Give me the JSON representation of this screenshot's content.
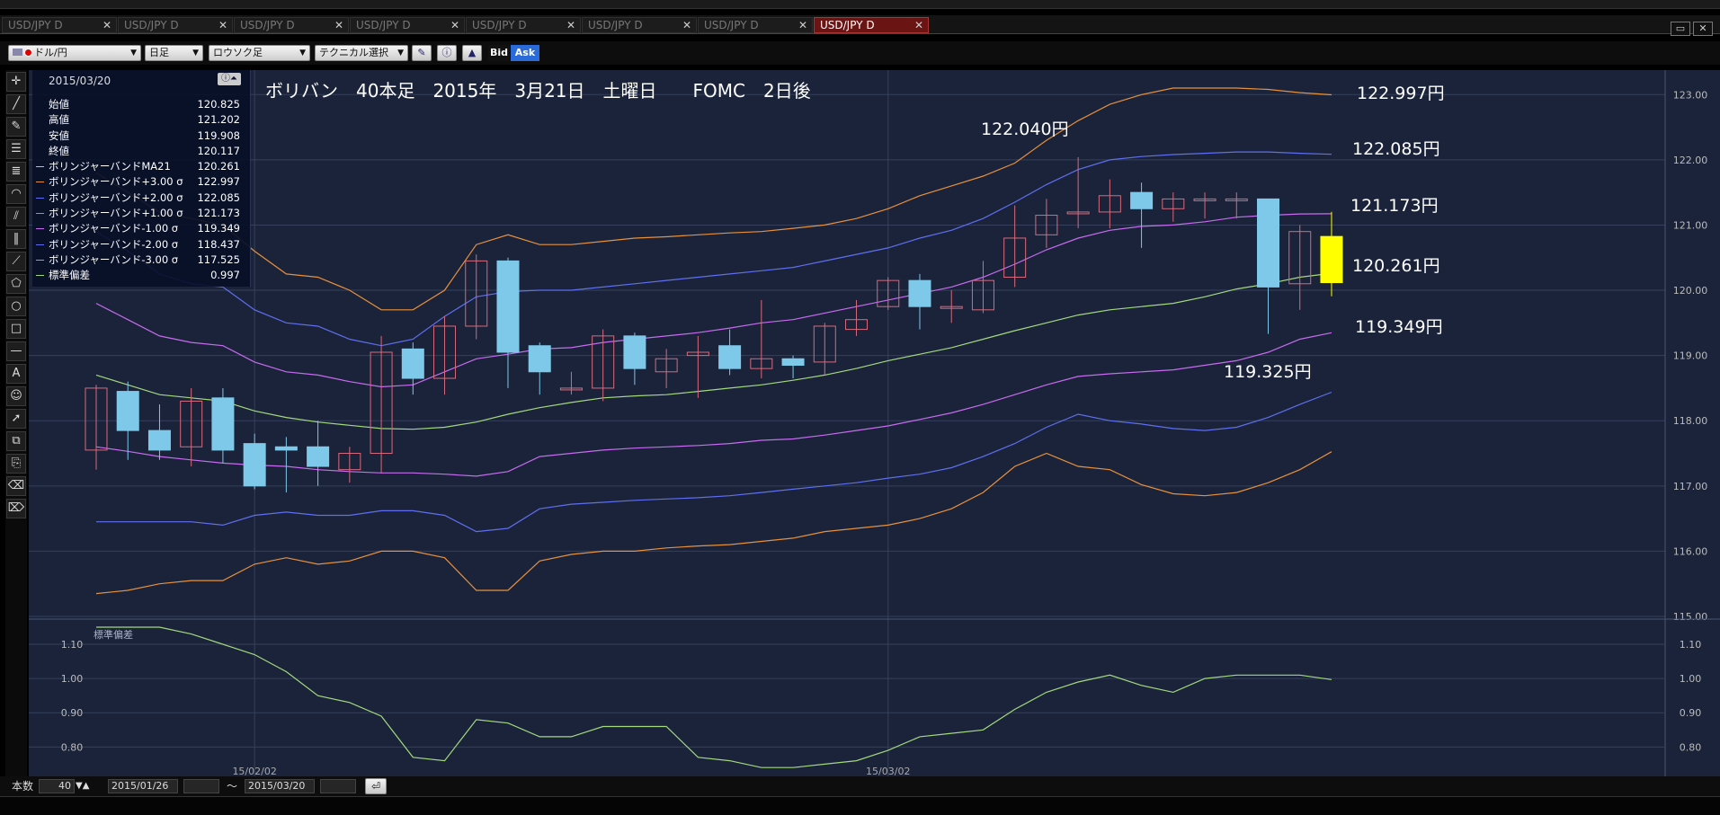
{
  "tabs": [
    "USD/JPY D",
    "USD/JPY D",
    "USD/JPY D",
    "USD/JPY D",
    "USD/JPY D",
    "USD/JPY D",
    "USD/JPY D",
    "USD/JPY D"
  ],
  "active_tab_index": 7,
  "toolbar": {
    "currency": "ドル/円",
    "period": "日足",
    "chart_type": "ロウソク足",
    "technical": "テクニカル選択",
    "bid": "Bid",
    "ask": "Ask"
  },
  "info": {
    "date": "2015/03/20",
    "rows": [
      {
        "label": "始値",
        "value": "120.825",
        "color": ""
      },
      {
        "label": "高値",
        "value": "121.202",
        "color": ""
      },
      {
        "label": "安値",
        "value": "119.908",
        "color": ""
      },
      {
        "label": "終値",
        "value": "120.117",
        "color": ""
      },
      {
        "label": "ボリンジャーバンドMA21",
        "value": "120.261",
        "color": "#a4d97f"
      },
      {
        "label": "ボリンジャーバンド+3.00 σ",
        "value": "122.997",
        "color": "#e8913b"
      },
      {
        "label": "ボリンジャーバンド+2.00 σ",
        "value": "122.085",
        "color": "#5f6ff0"
      },
      {
        "label": "ボリンジャーバンド+1.00 σ",
        "value": "121.173",
        "color": "#c86bf0"
      },
      {
        "label": "ボリンジャーバンド-1.00 σ",
        "value": "119.349",
        "color": "#c86bf0"
      },
      {
        "label": "ボリンジャーバンド-2.00 σ",
        "value": "118.437",
        "color": "#5f6ff0"
      },
      {
        "label": "ボリンジャーバンド-3.00 σ",
        "value": "117.525",
        "color": "#e8913b"
      },
      {
        "label": "標準偏差",
        "value": "0.997",
        "color": "#a4d97f"
      }
    ]
  },
  "bottom": {
    "count_label": "本数",
    "count_value": "40",
    "from_date": "2015/01/26",
    "tilde": "～",
    "to_date": "2015/03/20"
  },
  "chart_data": [
    {
      "type": "candlestick",
      "title": "ボリバン　40本足　2015年　3月21日　土曜日　　FOMC　2日後",
      "ylim": [
        115,
        123.1
      ],
      "yticks": [
        "115.00",
        "116.00",
        "117.00",
        "118.00",
        "119.00",
        "120.00",
        "121.00",
        "122.00",
        "123.00"
      ],
      "xticks": [
        {
          "index": 5,
          "label": "15/02/02"
        },
        {
          "index": 25,
          "label": "15/03/02"
        }
      ],
      "annotations": [
        {
          "text": "122.040円",
          "y": 122.04
        },
        {
          "text": "119.325円",
          "y": 119.325
        }
      ],
      "right_labels": [
        "122.997円",
        "122.085円",
        "121.173円",
        "120.261円",
        "119.349円"
      ],
      "candles": [
        {
          "o": 117.55,
          "h": 118.55,
          "l": 117.25,
          "c": 118.5
        },
        {
          "o": 118.45,
          "h": 118.6,
          "l": 117.4,
          "c": 117.85
        },
        {
          "o": 117.85,
          "h": 118.25,
          "l": 117.4,
          "c": 117.55
        },
        {
          "o": 117.6,
          "h": 118.5,
          "l": 117.3,
          "c": 118.3
        },
        {
          "o": 118.35,
          "h": 118.5,
          "l": 117.35,
          "c": 117.55
        },
        {
          "o": 117.65,
          "h": 117.8,
          "l": 116.95,
          "c": 117.0
        },
        {
          "o": 117.6,
          "h": 117.75,
          "l": 116.9,
          "c": 117.55
        },
        {
          "o": 117.6,
          "h": 118.0,
          "l": 117.0,
          "c": 117.3
        },
        {
          "o": 117.25,
          "h": 117.6,
          "l": 117.05,
          "c": 117.5
        },
        {
          "o": 117.5,
          "h": 119.3,
          "l": 117.2,
          "c": 119.05
        },
        {
          "o": 119.1,
          "h": 119.2,
          "l": 118.4,
          "c": 118.65
        },
        {
          "o": 118.65,
          "h": 119.6,
          "l": 118.4,
          "c": 119.45
        },
        {
          "o": 119.45,
          "h": 120.55,
          "l": 119.25,
          "c": 120.45
        },
        {
          "o": 120.45,
          "h": 120.5,
          "l": 118.5,
          "c": 119.05
        },
        {
          "o": 119.15,
          "h": 119.2,
          "l": 118.4,
          "c": 118.75
        },
        {
          "o": 118.5,
          "h": 118.75,
          "l": 118.4,
          "c": 118.5
        },
        {
          "o": 118.5,
          "h": 119.4,
          "l": 118.3,
          "c": 119.3
        },
        {
          "o": 119.3,
          "h": 119.35,
          "l": 118.55,
          "c": 118.8
        },
        {
          "o": 118.75,
          "h": 119.1,
          "l": 118.5,
          "c": 118.95
        },
        {
          "o": 119.0,
          "h": 119.3,
          "l": 118.35,
          "c": 119.05
        },
        {
          "o": 119.15,
          "h": 119.4,
          "l": 118.7,
          "c": 118.8
        },
        {
          "o": 118.8,
          "h": 119.85,
          "l": 118.65,
          "c": 118.95
        },
        {
          "o": 118.95,
          "h": 119.0,
          "l": 118.65,
          "c": 118.85
        },
        {
          "o": 118.9,
          "h": 119.5,
          "l": 118.7,
          "c": 119.45
        },
        {
          "o": 119.4,
          "h": 119.85,
          "l": 119.3,
          "c": 119.55
        },
        {
          "o": 119.75,
          "h": 120.2,
          "l": 119.7,
          "c": 120.15
        },
        {
          "o": 120.15,
          "h": 120.25,
          "l": 119.4,
          "c": 119.75
        },
        {
          "o": 119.75,
          "h": 120.0,
          "l": 119.5,
          "c": 119.75
        },
        {
          "o": 119.7,
          "h": 120.45,
          "l": 119.65,
          "c": 120.15
        },
        {
          "o": 120.2,
          "h": 121.3,
          "l": 120.05,
          "c": 120.8
        },
        {
          "o": 120.85,
          "h": 121.4,
          "l": 120.65,
          "c": 121.15
        },
        {
          "o": 121.2,
          "h": 122.04,
          "l": 120.95,
          "c": 121.2
        },
        {
          "o": 121.2,
          "h": 121.7,
          "l": 120.95,
          "c": 121.45
        },
        {
          "o": 121.5,
          "h": 121.65,
          "l": 120.65,
          "c": 121.25
        },
        {
          "o": 121.25,
          "h": 121.5,
          "l": 121.05,
          "c": 121.4
        },
        {
          "o": 121.4,
          "h": 121.5,
          "l": 121.1,
          "c": 121.4
        },
        {
          "o": 121.4,
          "h": 121.5,
          "l": 121.1,
          "c": 121.4
        },
        {
          "o": 121.4,
          "h": 121.4,
          "l": 119.33,
          "c": 120.05
        },
        {
          "o": 120.1,
          "h": 121.0,
          "l": 119.7,
          "c": 120.9
        },
        {
          "o": 120.825,
          "h": 121.202,
          "l": 119.908,
          "c": 120.117
        }
      ],
      "series": [
        {
          "label": "ボリンジャーバンドMA21",
          "color": "#a4d97f",
          "values": [
            118.7,
            118.55,
            118.4,
            118.35,
            118.3,
            118.15,
            118.05,
            117.98,
            117.93,
            117.88,
            117.87,
            117.9,
            117.98,
            118.1,
            118.2,
            118.28,
            118.35,
            118.38,
            118.4,
            118.45,
            118.5,
            118.55,
            118.62,
            118.7,
            118.8,
            118.92,
            119.02,
            119.12,
            119.25,
            119.38,
            119.5,
            119.62,
            119.7,
            119.75,
            119.8,
            119.9,
            120.02,
            120.1,
            120.2,
            120.261
          ]
        },
        {
          "label": "ボリンジャーバンド+1.00 σ",
          "color": "#c86bf0",
          "values": [
            119.8,
            119.55,
            119.3,
            119.2,
            119.15,
            118.9,
            118.75,
            118.7,
            118.6,
            118.52,
            118.55,
            118.75,
            118.95,
            119.02,
            119.1,
            119.12,
            119.2,
            119.25,
            119.3,
            119.35,
            119.42,
            119.5,
            119.55,
            119.65,
            119.75,
            119.85,
            119.95,
            120.05,
            120.2,
            120.4,
            120.62,
            120.8,
            120.92,
            120.98,
            121.0,
            121.05,
            121.12,
            121.15,
            121.17,
            121.173
          ]
        },
        {
          "label": "ボリンジャーバンド-1.00 σ",
          "color": "#c86bf0",
          "values": [
            117.6,
            117.53,
            117.45,
            117.4,
            117.35,
            117.32,
            117.3,
            117.25,
            117.22,
            117.2,
            117.2,
            117.18,
            117.15,
            117.22,
            117.45,
            117.5,
            117.55,
            117.58,
            117.6,
            117.62,
            117.65,
            117.7,
            117.72,
            117.78,
            117.85,
            117.92,
            118.02,
            118.12,
            118.25,
            118.4,
            118.55,
            118.68,
            118.72,
            118.75,
            118.78,
            118.85,
            118.92,
            119.05,
            119.25,
            119.349
          ]
        },
        {
          "label": "ボリンジャーバンド+2.00 σ",
          "color": "#5f6ff0",
          "values": [
            120.9,
            120.6,
            120.25,
            120.1,
            120.05,
            119.7,
            119.5,
            119.45,
            119.25,
            119.15,
            119.25,
            119.6,
            119.9,
            119.98,
            120.0,
            120.0,
            120.05,
            120.1,
            120.15,
            120.2,
            120.25,
            120.3,
            120.35,
            120.45,
            120.55,
            120.65,
            120.8,
            120.92,
            121.1,
            121.35,
            121.62,
            121.85,
            122.0,
            122.05,
            122.08,
            122.1,
            122.12,
            122.12,
            122.1,
            122.085
          ]
        },
        {
          "label": "ボリンジャーバンド-2.00 σ",
          "color": "#5f6ff0",
          "values": [
            116.45,
            116.45,
            116.45,
            116.45,
            116.4,
            116.55,
            116.6,
            116.55,
            116.55,
            116.62,
            116.62,
            116.55,
            116.3,
            116.35,
            116.65,
            116.72,
            116.75,
            116.78,
            116.8,
            116.82,
            116.85,
            116.9,
            116.95,
            117.0,
            117.05,
            117.12,
            117.18,
            117.28,
            117.45,
            117.65,
            117.9,
            118.1,
            118.0,
            117.95,
            117.88,
            117.85,
            117.9,
            118.05,
            118.25,
            118.437
          ]
        },
        {
          "label": "ボリンジャーバンド+3.00 σ",
          "color": "#e8913b",
          "values": [
            121.8,
            121.5,
            121.2,
            121.1,
            121.0,
            120.6,
            120.25,
            120.2,
            120.0,
            119.7,
            119.7,
            120.0,
            120.7,
            120.85,
            120.7,
            120.7,
            120.75,
            120.8,
            120.82,
            120.85,
            120.88,
            120.9,
            120.95,
            121.0,
            121.1,
            121.25,
            121.45,
            121.6,
            121.75,
            121.95,
            122.3,
            122.6,
            122.85,
            123.0,
            123.1,
            123.1,
            123.1,
            123.08,
            123.03,
            122.997
          ]
        },
        {
          "label": "ボリンジャーバンド-3.00 σ",
          "color": "#e8913b",
          "values": [
            115.35,
            115.4,
            115.5,
            115.55,
            115.55,
            115.8,
            115.9,
            115.8,
            115.85,
            116.0,
            116.0,
            115.9,
            115.4,
            115.4,
            115.85,
            115.95,
            116.0,
            116.0,
            116.05,
            116.08,
            116.1,
            116.15,
            116.2,
            116.3,
            116.35,
            116.4,
            116.5,
            116.65,
            116.9,
            117.3,
            117.5,
            117.3,
            117.25,
            117.02,
            116.88,
            116.85,
            116.9,
            117.05,
            117.25,
            117.525
          ]
        }
      ]
    },
    {
      "type": "line",
      "title": "標準偏差",
      "ylim": [
        0.73,
        1.15
      ],
      "yticks": [
        "0.80",
        "0.90",
        "1.00",
        "1.10"
      ],
      "series": [
        {
          "label": "標準偏差",
          "color": "#a4d97f",
          "values": [
            1.15,
            1.15,
            1.15,
            1.13,
            1.1,
            1.07,
            1.02,
            0.95,
            0.93,
            0.89,
            0.77,
            0.76,
            0.88,
            0.87,
            0.83,
            0.83,
            0.86,
            0.86,
            0.86,
            0.77,
            0.76,
            0.74,
            0.74,
            0.75,
            0.76,
            0.79,
            0.83,
            0.84,
            0.85,
            0.91,
            0.96,
            0.99,
            1.01,
            0.98,
            0.96,
            1.0,
            1.01,
            1.01,
            1.01,
            0.997
          ]
        }
      ]
    }
  ]
}
